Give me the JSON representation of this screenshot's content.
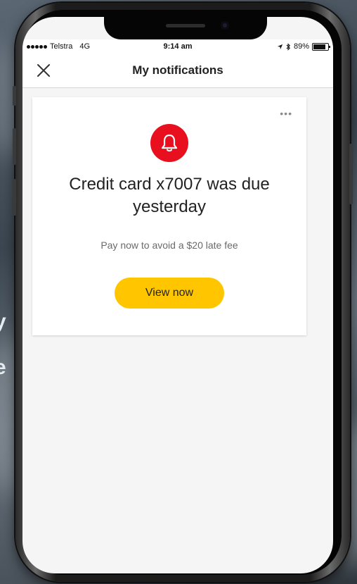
{
  "background": {
    "fragments": [
      "y",
      "e"
    ]
  },
  "status_bar": {
    "carrier": "Telstra",
    "network": "4G",
    "time": "9:14 am",
    "battery": "89%"
  },
  "header": {
    "title": "My notifications"
  },
  "notification": {
    "title": "Credit card x7007 was due yesterday",
    "subtitle": "Pay now to avoid a $20 late fee",
    "button_label": "View now",
    "more_label": "•••"
  },
  "icons": {
    "close": "close-icon",
    "bell": "bell-icon",
    "more": "more-icon"
  },
  "colors": {
    "alert_red": "#e8101f",
    "button_yellow": "#ffc600"
  }
}
